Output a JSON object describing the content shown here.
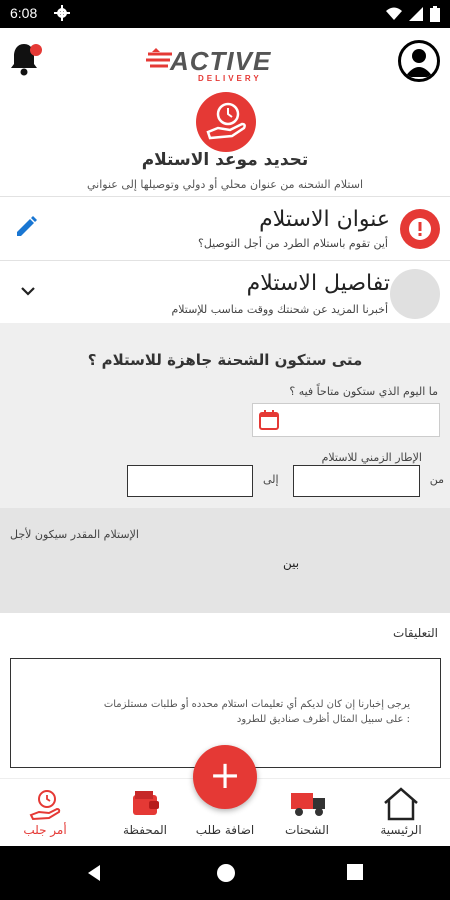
{
  "status_bar": {
    "time": "6:08"
  },
  "header": {
    "logo_text": "ACTIVE",
    "logo_sub": "DELIVERY"
  },
  "page": {
    "title": "تحديد موعد الاستلام",
    "subtitle": "استلام الشحنه من عنوان محلي أو دولي وتوصيلها إلى عنواني"
  },
  "steps": [
    {
      "title": "عنوان الاستلام",
      "subtitle": "أين تقوم باستلام الطرد من أجل التوصيل؟"
    },
    {
      "title": "تفاصيل الاستلام",
      "subtitle": "أخبرنا المزيد عن شحنتك ووقت مناسب للإستلام"
    }
  ],
  "form": {
    "question": "متى ستكون الشحنة جاهزة للاستلام ؟",
    "day_label": "ما اليوم الذي ستكون متاحاً فيه ؟",
    "timeframe_label": "الإطار الزمني للاستلام",
    "from_label": "من",
    "to_label": "إلى",
    "estimate_label": "الإستلام المقدر سيكون لأجل",
    "between_label": "بين"
  },
  "notes": {
    "label": "التعليقات",
    "placeholder": "يرجى إخبارنا إن كان لديكم أي تعليمات استلام محدده أو طلبات مستلزمات : على سبيل المثال أظرف صناديق للطرود"
  },
  "bottom_nav": [
    {
      "label": "أمر جلب",
      "icon": "pickup-order-icon",
      "active": true
    },
    {
      "label": "المحفظة",
      "icon": "wallet-icon",
      "active": false
    },
    {
      "label": "اضافة طلب",
      "icon": "add-order-icon",
      "active": false
    },
    {
      "label": "الشحنات",
      "icon": "truck-icon",
      "active": false
    },
    {
      "label": "الرئيسية",
      "icon": "home-icon",
      "active": false
    }
  ],
  "fab": {
    "label": "+"
  },
  "colors": {
    "accent": "#e53935",
    "form_bg": "#efefef",
    "edit_blue": "#1976d2"
  }
}
